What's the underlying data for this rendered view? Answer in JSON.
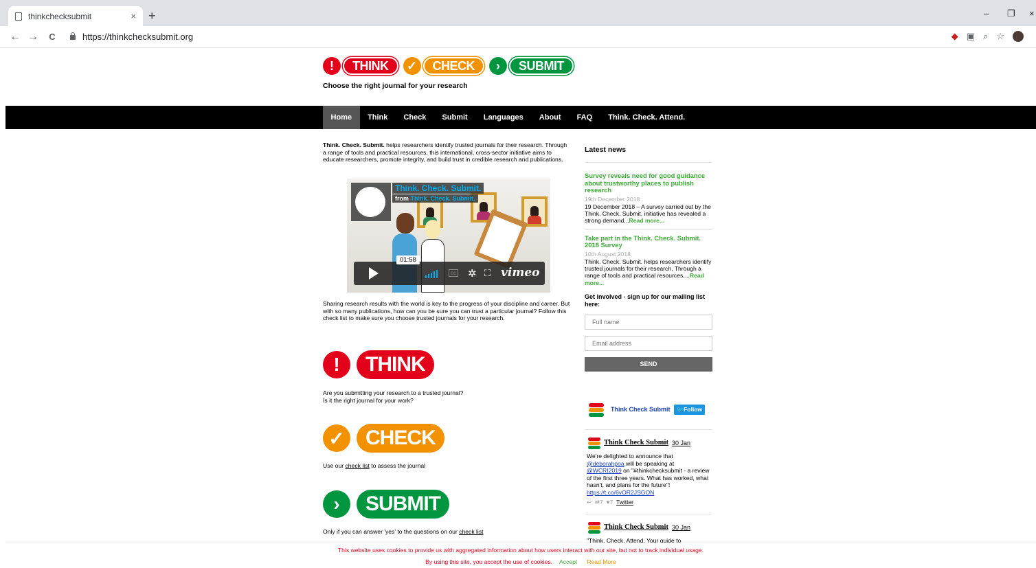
{
  "browser": {
    "tab_title": "thinkchecksubmit",
    "tab_close": "×",
    "new_tab": "+",
    "url": "https://thinkchecksubmit.org",
    "back": "←",
    "forward": "→",
    "reload": "C"
  },
  "logo": {
    "think_icon": "!",
    "think": "THINK",
    "check_icon": "✓",
    "check": "CHECK",
    "submit_icon": "›",
    "submit": "SUBMIT",
    "tagline": "Choose the right journal for your research"
  },
  "nav": {
    "items": [
      "Home",
      "Think",
      "Check",
      "Submit",
      "Languages",
      "About",
      "FAQ",
      "Think. Check. Attend."
    ]
  },
  "intro": {
    "bold": "Think. Check. Submit.",
    "text": " helps researchers identify trusted journals for their research. Through a range of tools and practical resources, this international, cross-sector initiative aims to educate researchers, promote integrity, and build trust in credible research and publications."
  },
  "video": {
    "title": "Think. Check. Submit.",
    "from_label": "from ",
    "from_name": "Think. Check. Submit.",
    "duration": "01:58",
    "brand": "vimeo"
  },
  "para2": "Sharing research results with the world is key to the progress of your discipline and career. But with so many publications, how can you be sure you can trust a particular journal? Follow this check list to make sure you choose trusted journals for your research.",
  "think_section": {
    "icon": "!",
    "label": "THINK",
    "line1": "Are you submitting your research to a trusted journal?",
    "line2": "Is it the right journal for your work?"
  },
  "check_section": {
    "icon": "✓",
    "label": "CHECK",
    "pre": "Use our ",
    "link": "check list",
    "post": " to assess the journal"
  },
  "submit_section": {
    "icon": "›",
    "label": "SUBMIT",
    "pre": "Only if you can answer 'yes' to the questions on our ",
    "link": "check list"
  },
  "sidebar": {
    "latest_news": "Latest news",
    "news": [
      {
        "headline": "Survey reveals need for good guidance about trustworthy places to publish research",
        "date": "19th December 2018",
        "body": "19 December 2018 – A survey carried out by the Think. Check. Submit. initiative has revealed a strong demand...",
        "more": "Read more..."
      },
      {
        "headline": "Take part in the Think. Check. Submit. 2018 Survey",
        "date": "10th August 2018",
        "body": "Think. Check. Submit. helps researchers identify trusted journals for their research. Through a range of tools and practical resources,...",
        "more": "Read more..."
      }
    ],
    "signup_title": "Get involved - sign up for our mailing list here:",
    "fullname_placeholder": "Full name",
    "email_placeholder": "Email address",
    "send_label": "SEND"
  },
  "twitter": {
    "account": "Think Check Submit",
    "follow": "Follow",
    "tweets": [
      {
        "user": "Think Check Submit",
        "date": "30 Jan",
        "t1": "We're delighted to announce that ",
        "mention1": "@deborahpoa",
        "t2": " will be speaking at ",
        "mention2": "@WCRI2019",
        "t3": " on \"#thinkchecksubmit - a review of the first three years. What has worked, what hasn't, and plans for the future\"! ",
        "url": "https://t.co/6vOR2JSGON",
        "retweets": "7",
        "likes": "7",
        "source": "Twitter"
      },
      {
        "user": "Think Check Submit",
        "date": "30 Jan",
        "t1": "\"Think. Check. Attend. Your guide to"
      }
    ]
  },
  "cookie": {
    "line1": "This website uses cookies to provide us with aggregated information about how users interact with our site, but not to track individual usage.",
    "line2": "By using this site, you accept the use of cookies.",
    "accept": "Accept",
    "read_more": "Read More"
  },
  "colors": {
    "think_red": "#e2001a",
    "check_orange": "#f39200",
    "submit_green": "#009640",
    "news_green": "#3ba935"
  }
}
